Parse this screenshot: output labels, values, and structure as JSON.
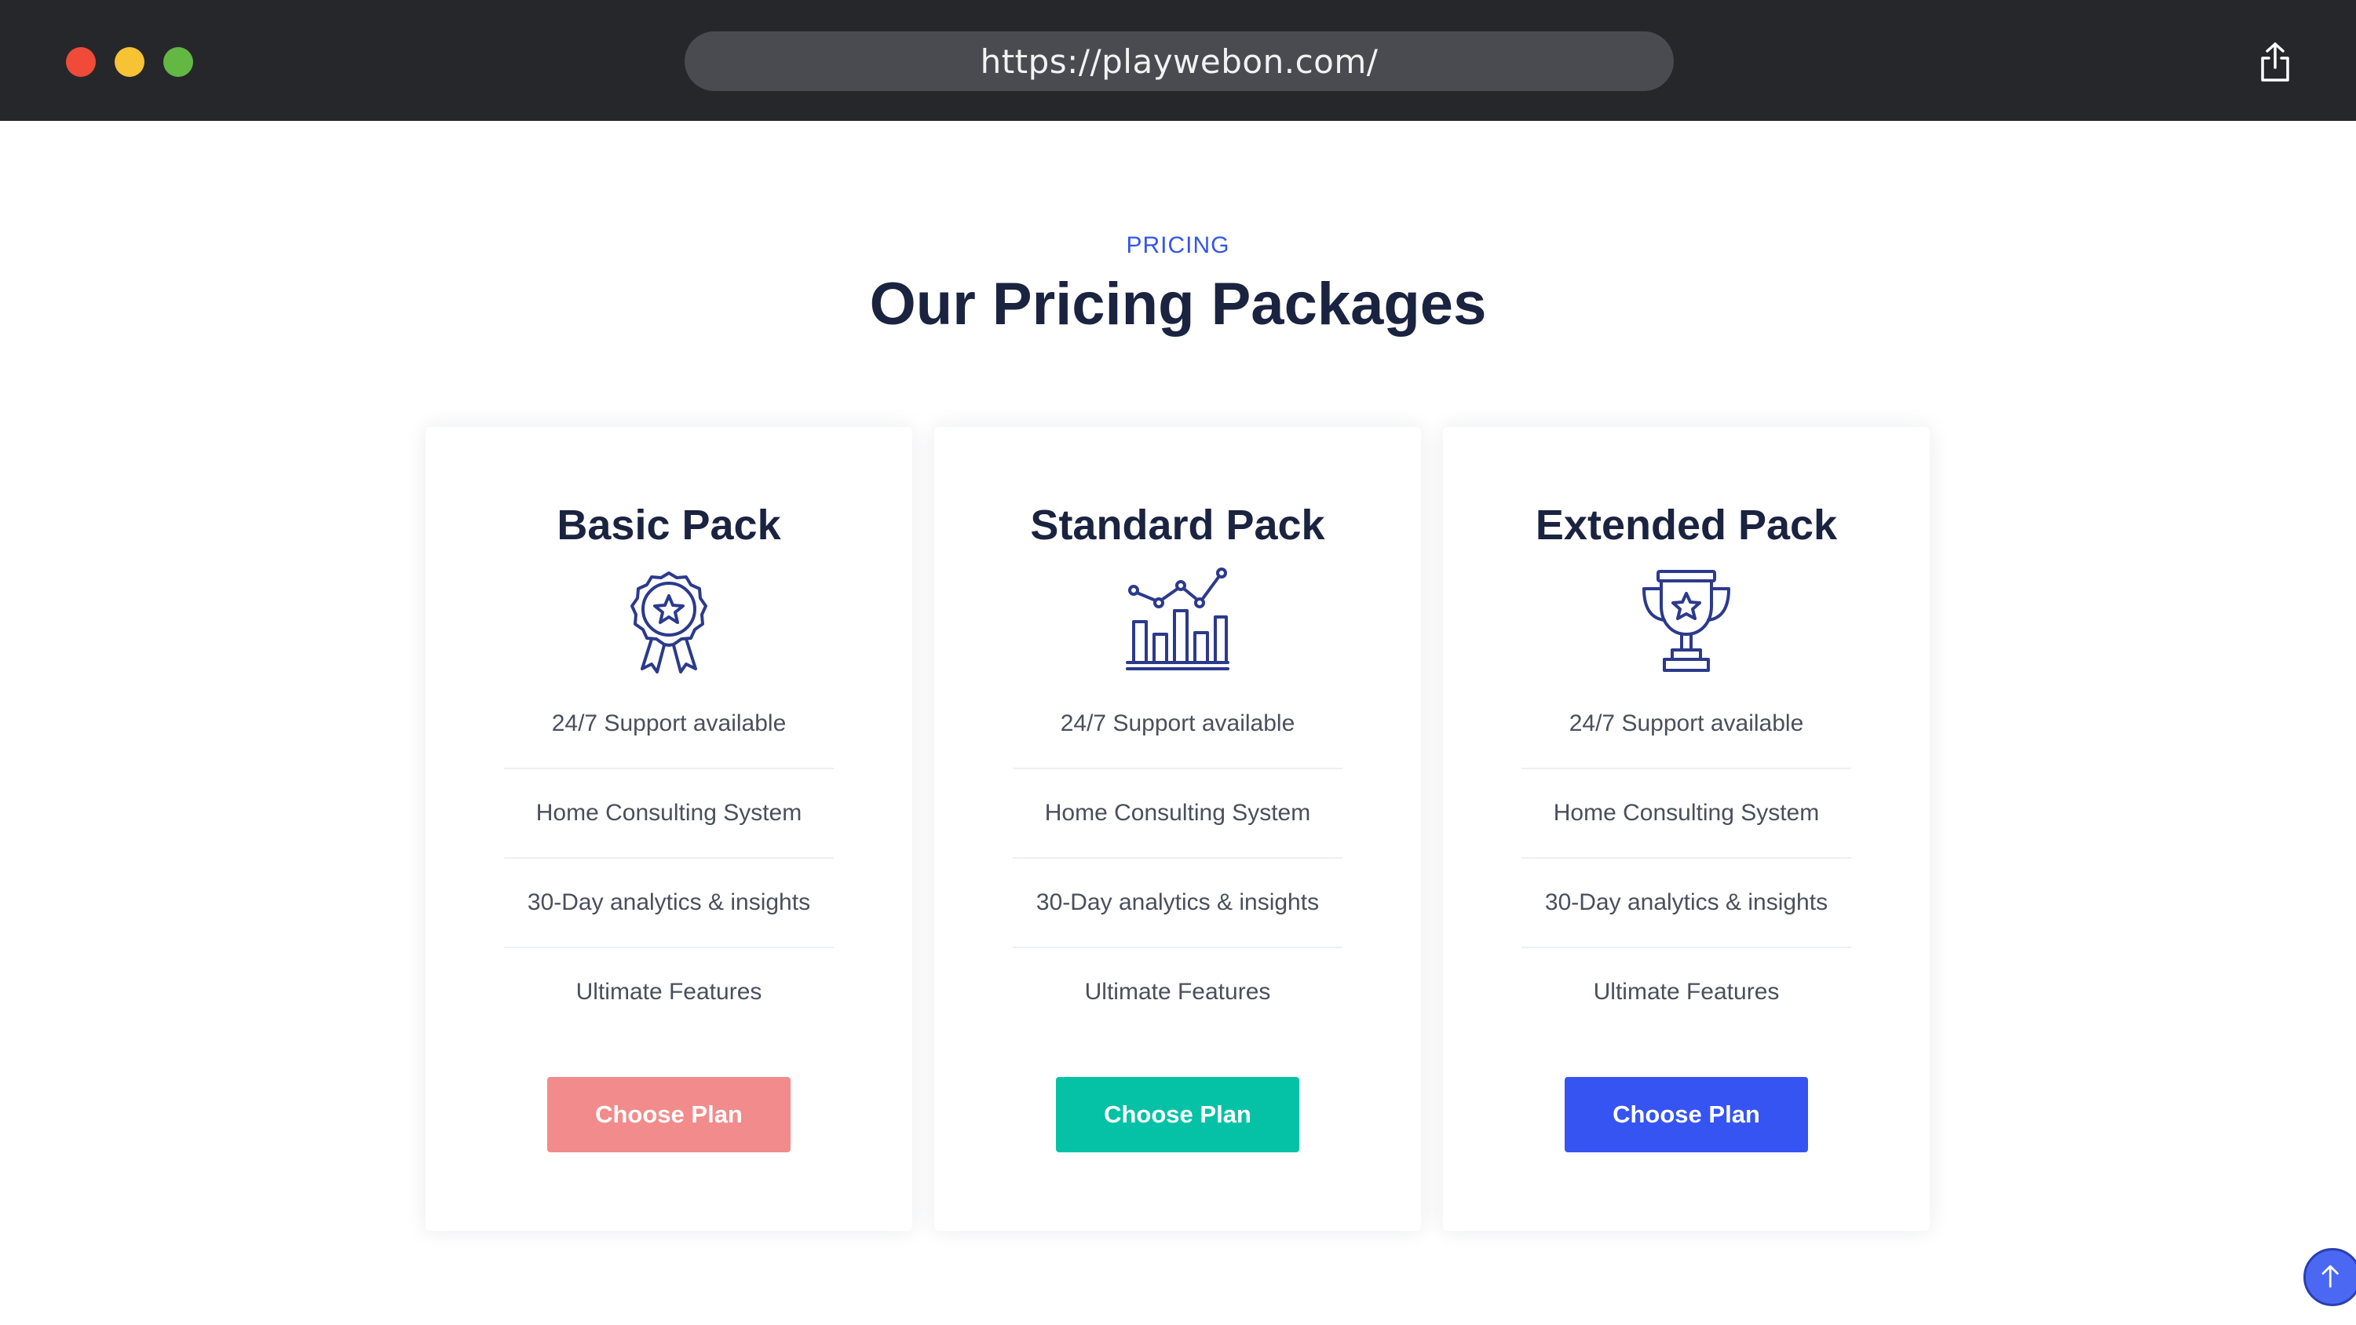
{
  "browser": {
    "url": "https://playwebon.com/"
  },
  "section": {
    "eyebrow": "PRICING",
    "title": "Our Pricing Packages"
  },
  "plans": [
    {
      "name": "Basic Pack",
      "icon": "award-badge-icon",
      "features": [
        "24/7 Support available",
        "Home Consulting System",
        "30-Day analytics & insights",
        "Ultimate Features"
      ],
      "button_label": "Choose Plan",
      "button_color": "#f28b8b"
    },
    {
      "name": "Standard Pack",
      "icon": "bar-chart-icon",
      "features": [
        "24/7 Support available",
        "Home Consulting System",
        "30-Day analytics & insights",
        "Ultimate Features"
      ],
      "button_label": "Choose Plan",
      "button_color": "#05c2a6"
    },
    {
      "name": "Extended Pack",
      "icon": "trophy-icon",
      "features": [
        "24/7 Support available",
        "Home Consulting System",
        "30-Day analytics & insights",
        "Ultimate Features"
      ],
      "button_label": "Choose Plan",
      "button_color": "#3554f2"
    }
  ],
  "colors": {
    "accent": "#3556e8",
    "heading": "#1a2340",
    "icon": "#2c3a8c"
  }
}
